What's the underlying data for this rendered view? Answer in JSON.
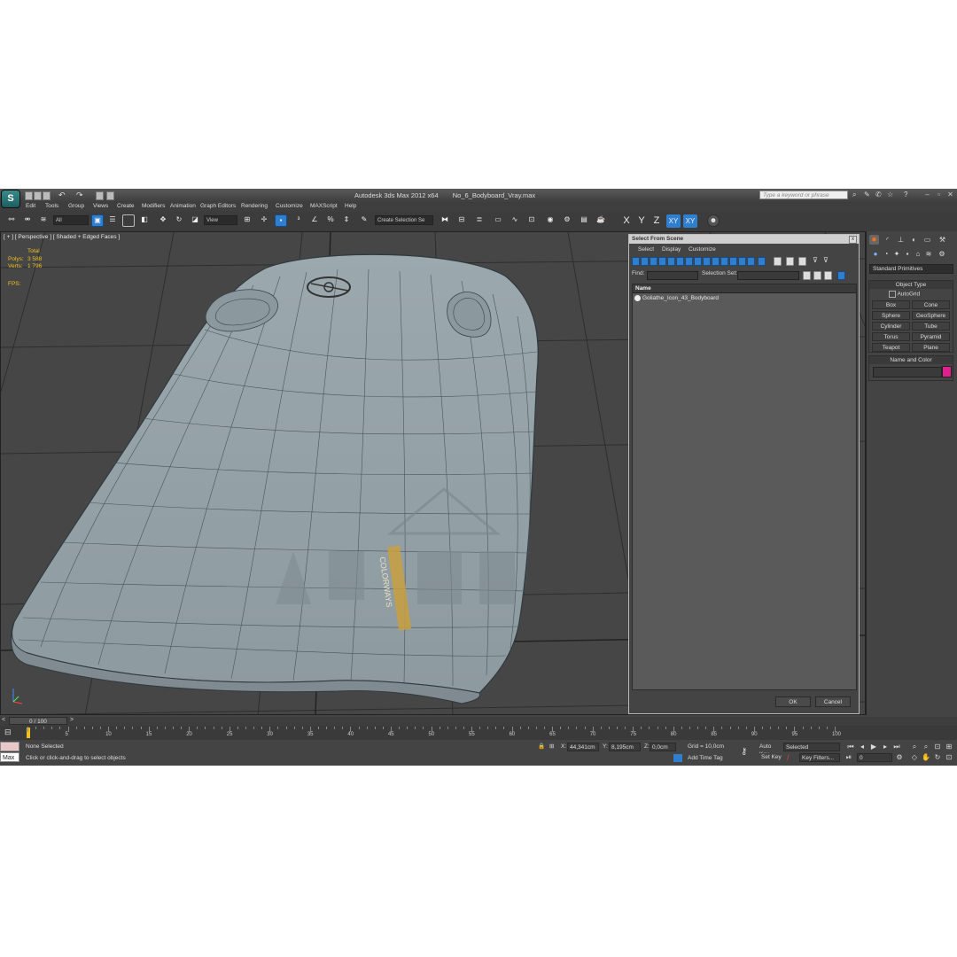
{
  "app": {
    "title": "Autodesk 3ds Max  2012 x64",
    "file": "No_6_Bodyboard_Vray.max",
    "search_placeholder": "Type a keyword or phrase"
  },
  "menu": [
    "Edit",
    "Tools",
    "Group",
    "Views",
    "Create",
    "Modifiers",
    "Animation",
    "Graph Editors",
    "Rendering",
    "Customize",
    "MAXScript",
    "Help"
  ],
  "toolbar": {
    "filter": "All",
    "ref_coord": "View",
    "selection_set": "Create Selection Se",
    "axes": [
      "X",
      "Y",
      "Z",
      "XY",
      "XY"
    ]
  },
  "viewport": {
    "label": "[ + ] [ Perspective ] [ Shaded + Edged Faces ]",
    "stats": {
      "total_label": "Total",
      "polys_label": "Polys:",
      "polys": "3 588",
      "verts_label": "Verts:",
      "verts": "1 796",
      "fps_label": "FPS:"
    },
    "board_text": "COLORWAYS"
  },
  "dialog": {
    "title": "Select From Scene",
    "close": "x",
    "menu": [
      "Select",
      "Display",
      "Customize"
    ],
    "find_label": "Find:",
    "selection_set_label": "Selection Set:",
    "column_header": "Name",
    "items": [
      "Goliathe_Icon_43_Bodyboard"
    ],
    "ok": "OK",
    "cancel": "Cancel"
  },
  "command_panel": {
    "category": "Standard Primitives",
    "object_type_title": "Object Type",
    "autogrid": "AutoGrid",
    "primitives": [
      "Box",
      "Cone",
      "Sphere",
      "GeoSphere",
      "Cylinder",
      "Tube",
      "Torus",
      "Pyramid",
      "Teapot",
      "Plane"
    ],
    "name_color_title": "Name and Color",
    "color": "#e0208c"
  },
  "timeline": {
    "frame": "0 / 100",
    "ticks": [
      "5",
      "10",
      "15",
      "20",
      "25",
      "30",
      "35",
      "40",
      "45",
      "50",
      "55",
      "60",
      "65",
      "70",
      "75",
      "80",
      "85",
      "90",
      "95",
      "100"
    ]
  },
  "status": {
    "max_label": "Max",
    "selection": "None Selected",
    "prompt": "Click or click-and-drag to select objects",
    "x_label": "X:",
    "x": "44,341cm",
    "y_label": "Y:",
    "y": "8,195cm",
    "z_label": "Z:",
    "z": "0,0cm",
    "grid": "Grid = 10,0cm",
    "add_time_tag": "Add Time Tag",
    "auto_key": "Auto Key",
    "auto_key_mode": "Selected",
    "set_key": "Set Key",
    "key_filters": "Key Filters...",
    "current_frame": "0"
  }
}
